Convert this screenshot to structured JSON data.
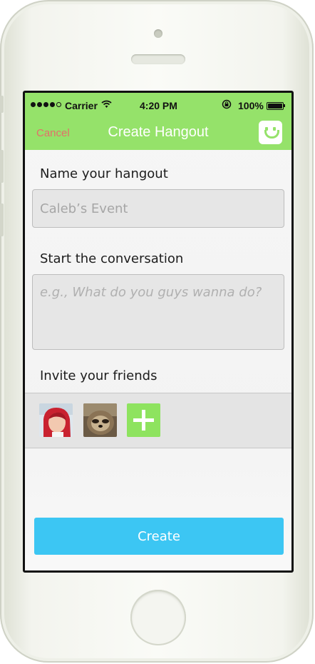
{
  "status_bar": {
    "carrier": "Carrier",
    "time": "4:20 PM",
    "battery": "100%"
  },
  "nav": {
    "cancel": "Cancel",
    "title": "Create Hangout"
  },
  "form": {
    "name_label": "Name your hangout",
    "name_placeholder": "Caleb’s Event",
    "conversation_label": "Start the conversation",
    "conversation_placeholder": "e.g., What do you guys wanna do?",
    "friends_label": "Invite your friends"
  },
  "create_label": "Create",
  "colors": {
    "nav_bar": "#95e26a",
    "cancel_text": "#e46f6a",
    "create_button": "#3cc6f3",
    "add_button": "#8ee35f"
  },
  "icons": [
    "wifi-icon",
    "lock-rotation-icon",
    "battery-icon",
    "smiley-logo-icon",
    "plus-icon"
  ]
}
